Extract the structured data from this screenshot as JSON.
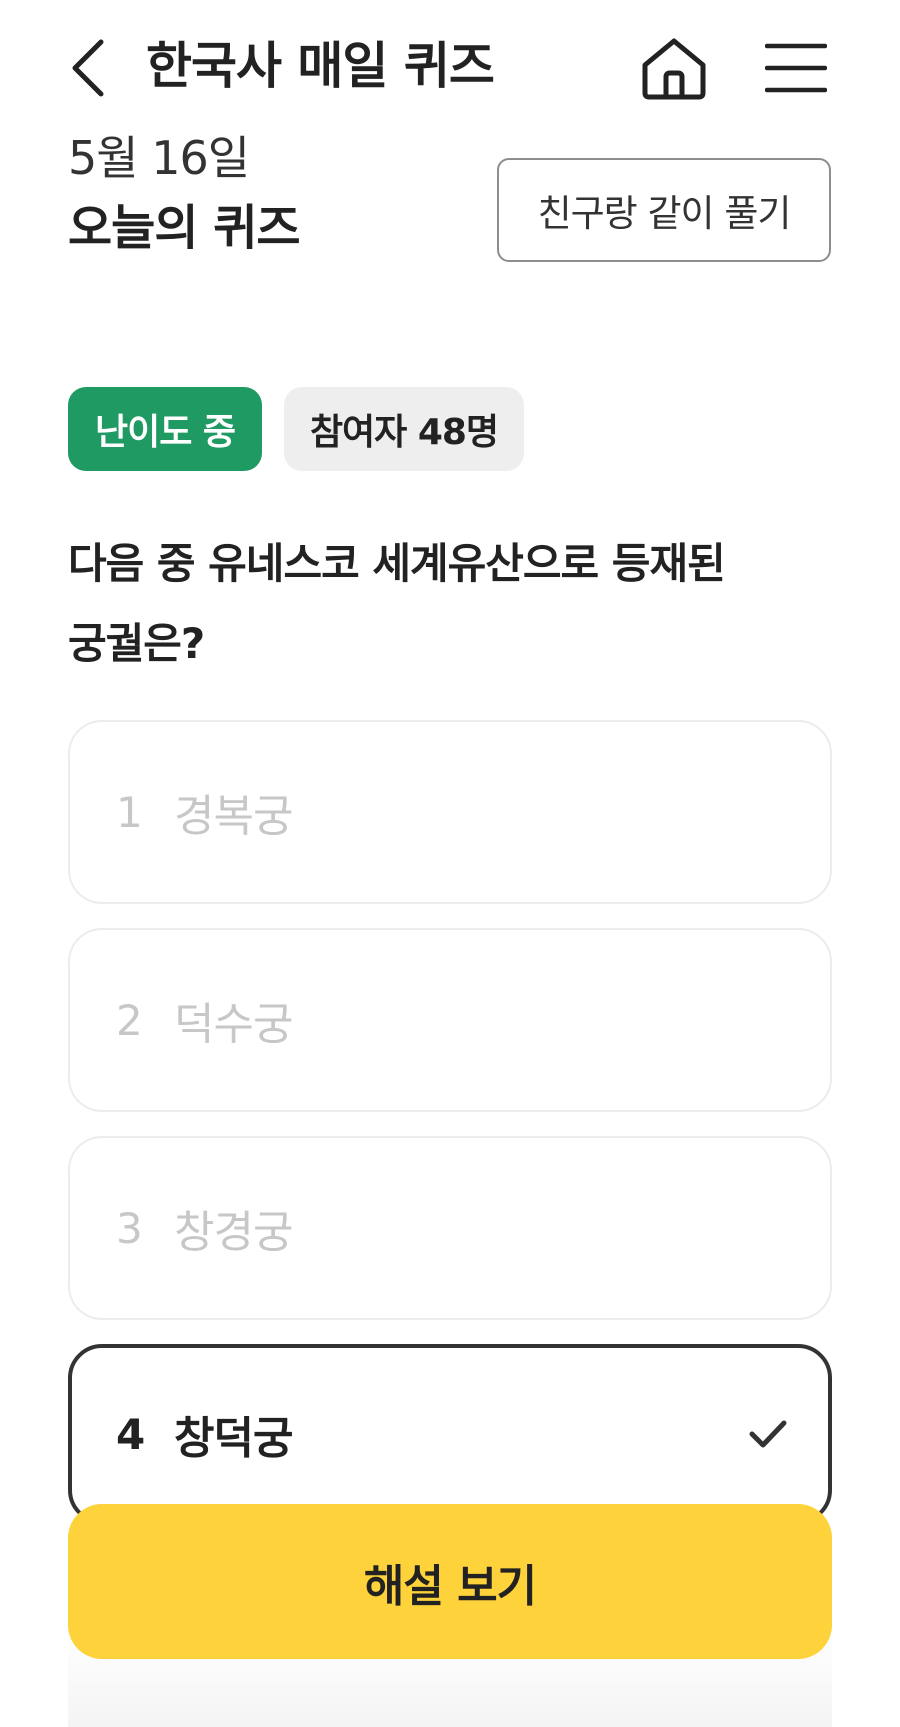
{
  "header": {
    "title": "한국사 매일 퀴즈",
    "back_icon": "chevron-left-icon",
    "home_icon": "home-icon",
    "menu_icon": "hamburger-menu-icon"
  },
  "quiz": {
    "date": "5월 16일",
    "title": "오늘의 퀴즈",
    "friend_button": "친구랑 같이 풀기",
    "level_badge": "난이도 중",
    "participants_badge": "참여자 48명",
    "question_line1": "다음 중 유네스코 세계유산으로 등재된",
    "question_line2": "궁궐은?",
    "options": [
      {
        "number": "1",
        "text": "경복궁",
        "selected": false
      },
      {
        "number": "2",
        "text": "덕수궁",
        "selected": false
      },
      {
        "number": "3",
        "text": "창경궁",
        "selected": false
      },
      {
        "number": "4",
        "text": "창덕궁",
        "selected": true
      }
    ],
    "explain_button": "해설 보기"
  },
  "colors": {
    "level_badge_bg": "#1f9a62",
    "participants_badge_bg": "#eeeeee",
    "explain_button_bg": "#fdd23a",
    "selected_border": "#333333"
  }
}
